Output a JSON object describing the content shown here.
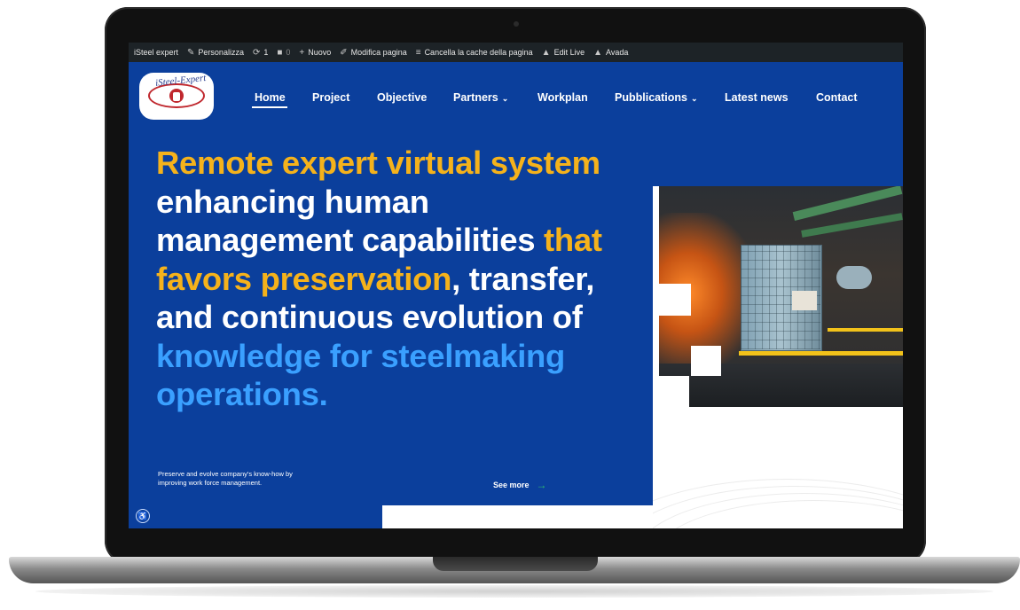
{
  "admin_bar": {
    "site_name": "iSteel expert",
    "personalize": "Personalizza",
    "updates_count": "1",
    "comments_count": "0",
    "new": "Nuovo",
    "edit_page": "Modifica pagina",
    "clear_cache": "Cancella la cache della pagina",
    "edit_live": "Edit Live",
    "avada": "Avada"
  },
  "logo": {
    "text": "iSteel-Expert"
  },
  "nav": {
    "items": [
      {
        "label": "Home",
        "active": true
      },
      {
        "label": "Project"
      },
      {
        "label": "Objective"
      },
      {
        "label": "Partners",
        "has_dropdown": true
      },
      {
        "label": "Workplan"
      },
      {
        "label": "Pubblications",
        "has_dropdown": true
      },
      {
        "label": "Latest news"
      },
      {
        "label": "Contact"
      }
    ]
  },
  "hero": {
    "line1": "Remote expert virtual system",
    "line2": "enhancing human",
    "line3_white": "management capabilities ",
    "line3_yellow": "that",
    "line4_yellow": "favors preservation",
    "line4_white": ", transfer,",
    "line5": "and continuous evolution of",
    "line6": "knowledge for steelmaking",
    "line7": "operations.",
    "subtext": "Preserve and evolve company's know-how by improving work force management.",
    "see_more": "See more"
  },
  "colors": {
    "hero_bg": "#0b3f9c",
    "accent_yellow": "#f5b21b",
    "accent_blue": "#3aa0ff",
    "admin_bar_bg": "#1d2327",
    "arrow_green": "#2fbf6f"
  },
  "icons": {
    "personalize": "brush-icon",
    "updates": "refresh-icon",
    "comments": "comment-icon",
    "new": "plus-icon",
    "edit": "pencil-icon",
    "cache": "database-icon",
    "edit_live": "avada-icon",
    "avada": "avada-icon",
    "see_more_arrow": "arrow-right-icon",
    "accessibility": "accessibility-icon"
  }
}
